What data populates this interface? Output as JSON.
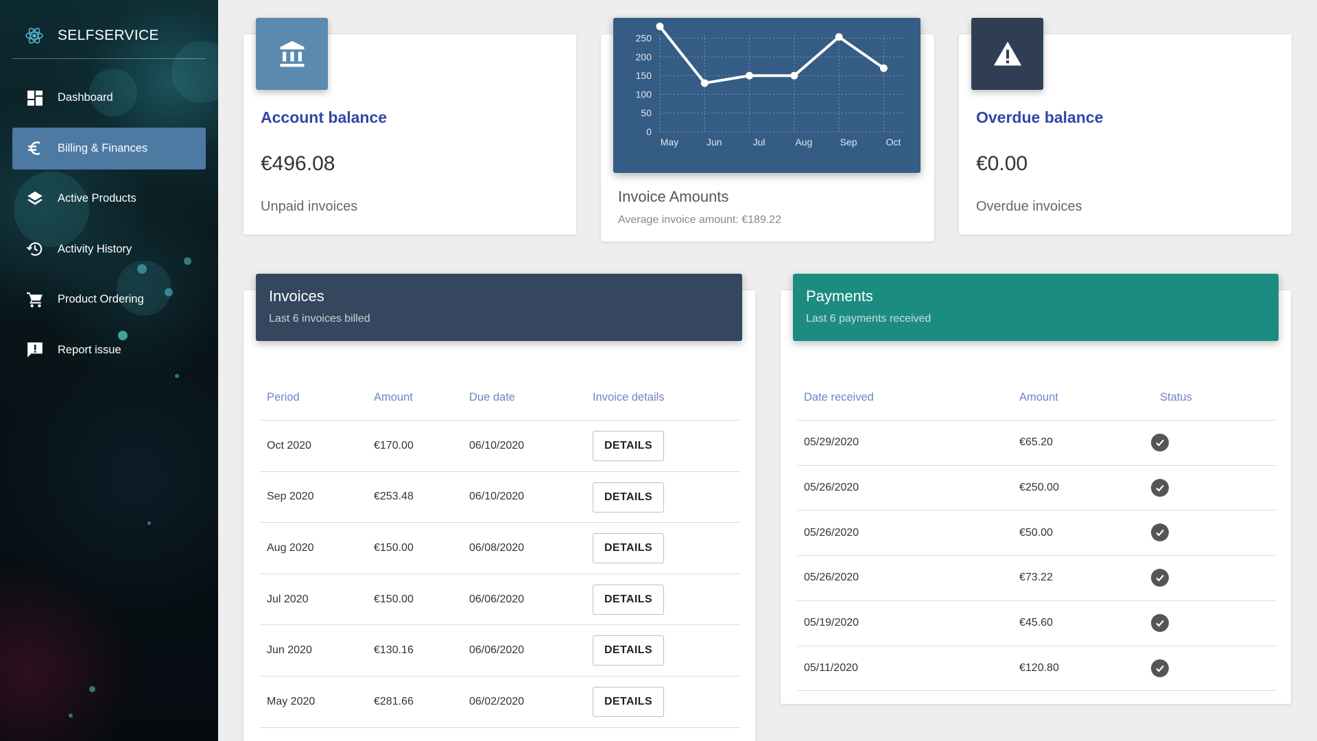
{
  "app": {
    "title": "SELFSERVICE"
  },
  "sidebar": {
    "items": [
      {
        "label": "Dashboard",
        "icon": "dashboard-icon",
        "active": false
      },
      {
        "label": "Billing & Finances",
        "icon": "euro-icon",
        "active": true
      },
      {
        "label": "Active Products",
        "icon": "layers-icon",
        "active": false
      },
      {
        "label": "Activity History",
        "icon": "history-icon",
        "active": false
      },
      {
        "label": "Product Ordering",
        "icon": "cart-icon",
        "active": false
      },
      {
        "label": "Report issue",
        "icon": "report-icon",
        "active": false
      }
    ]
  },
  "cards": {
    "account_balance": {
      "title": "Account balance",
      "value": "€496.08",
      "sub": "Unpaid invoices",
      "icon": "bank-icon",
      "color": "#5a8ab0"
    },
    "invoice_amounts": {
      "title": "Invoice Amounts",
      "sub": "Average invoice amount: €189.22"
    },
    "overdue_balance": {
      "title": "Overdue balance",
      "value": "€0.00",
      "sub": "Overdue invoices",
      "icon": "warning-icon",
      "color": "#2f3e52"
    }
  },
  "chart_data": {
    "type": "line",
    "categories": [
      "May",
      "Jun",
      "Jul",
      "Aug",
      "Sep",
      "Oct"
    ],
    "values": [
      281.66,
      130.16,
      150,
      150,
      253.48,
      170
    ],
    "yticks": [
      0,
      50,
      100,
      150,
      200,
      250
    ],
    "ylim": [
      0,
      270
    ],
    "grid": true,
    "background": "#355c85",
    "line_color": "#ffffff"
  },
  "invoices": {
    "title": "Invoices",
    "subtitle": "Last 6 invoices billed",
    "color": "#34475e",
    "headers": [
      "Period",
      "Amount",
      "Due date",
      "Invoice details"
    ],
    "button_label": "DETAILS",
    "rows": [
      {
        "period": "Oct 2020",
        "amount": "€170.00",
        "due": "06/10/2020"
      },
      {
        "period": "Sep 2020",
        "amount": "€253.48",
        "due": "06/10/2020"
      },
      {
        "period": "Aug 2020",
        "amount": "€150.00",
        "due": "06/08/2020"
      },
      {
        "period": "Jul 2020",
        "amount": "€150.00",
        "due": "06/06/2020"
      },
      {
        "period": "Jun 2020",
        "amount": "€130.16",
        "due": "06/06/2020"
      },
      {
        "period": "May 2020",
        "amount": "€281.66",
        "due": "06/02/2020"
      }
    ]
  },
  "payments": {
    "title": "Payments",
    "subtitle": "Last 6 payments received",
    "color": "#1c8c80",
    "headers": [
      "Date received",
      "Amount",
      "Status"
    ],
    "rows": [
      {
        "date": "05/29/2020",
        "amount": "€65.20",
        "status": "check-circle-icon"
      },
      {
        "date": "05/26/2020",
        "amount": "€250.00",
        "status": "check-circle-icon"
      },
      {
        "date": "05/26/2020",
        "amount": "€50.00",
        "status": "check-circle-icon"
      },
      {
        "date": "05/26/2020",
        "amount": "€73.22",
        "status": "check-circle-icon"
      },
      {
        "date": "05/19/2020",
        "amount": "€45.60",
        "status": "check-circle-icon"
      },
      {
        "date": "05/11/2020",
        "amount": "€120.80",
        "status": "check-circle-icon"
      }
    ]
  }
}
